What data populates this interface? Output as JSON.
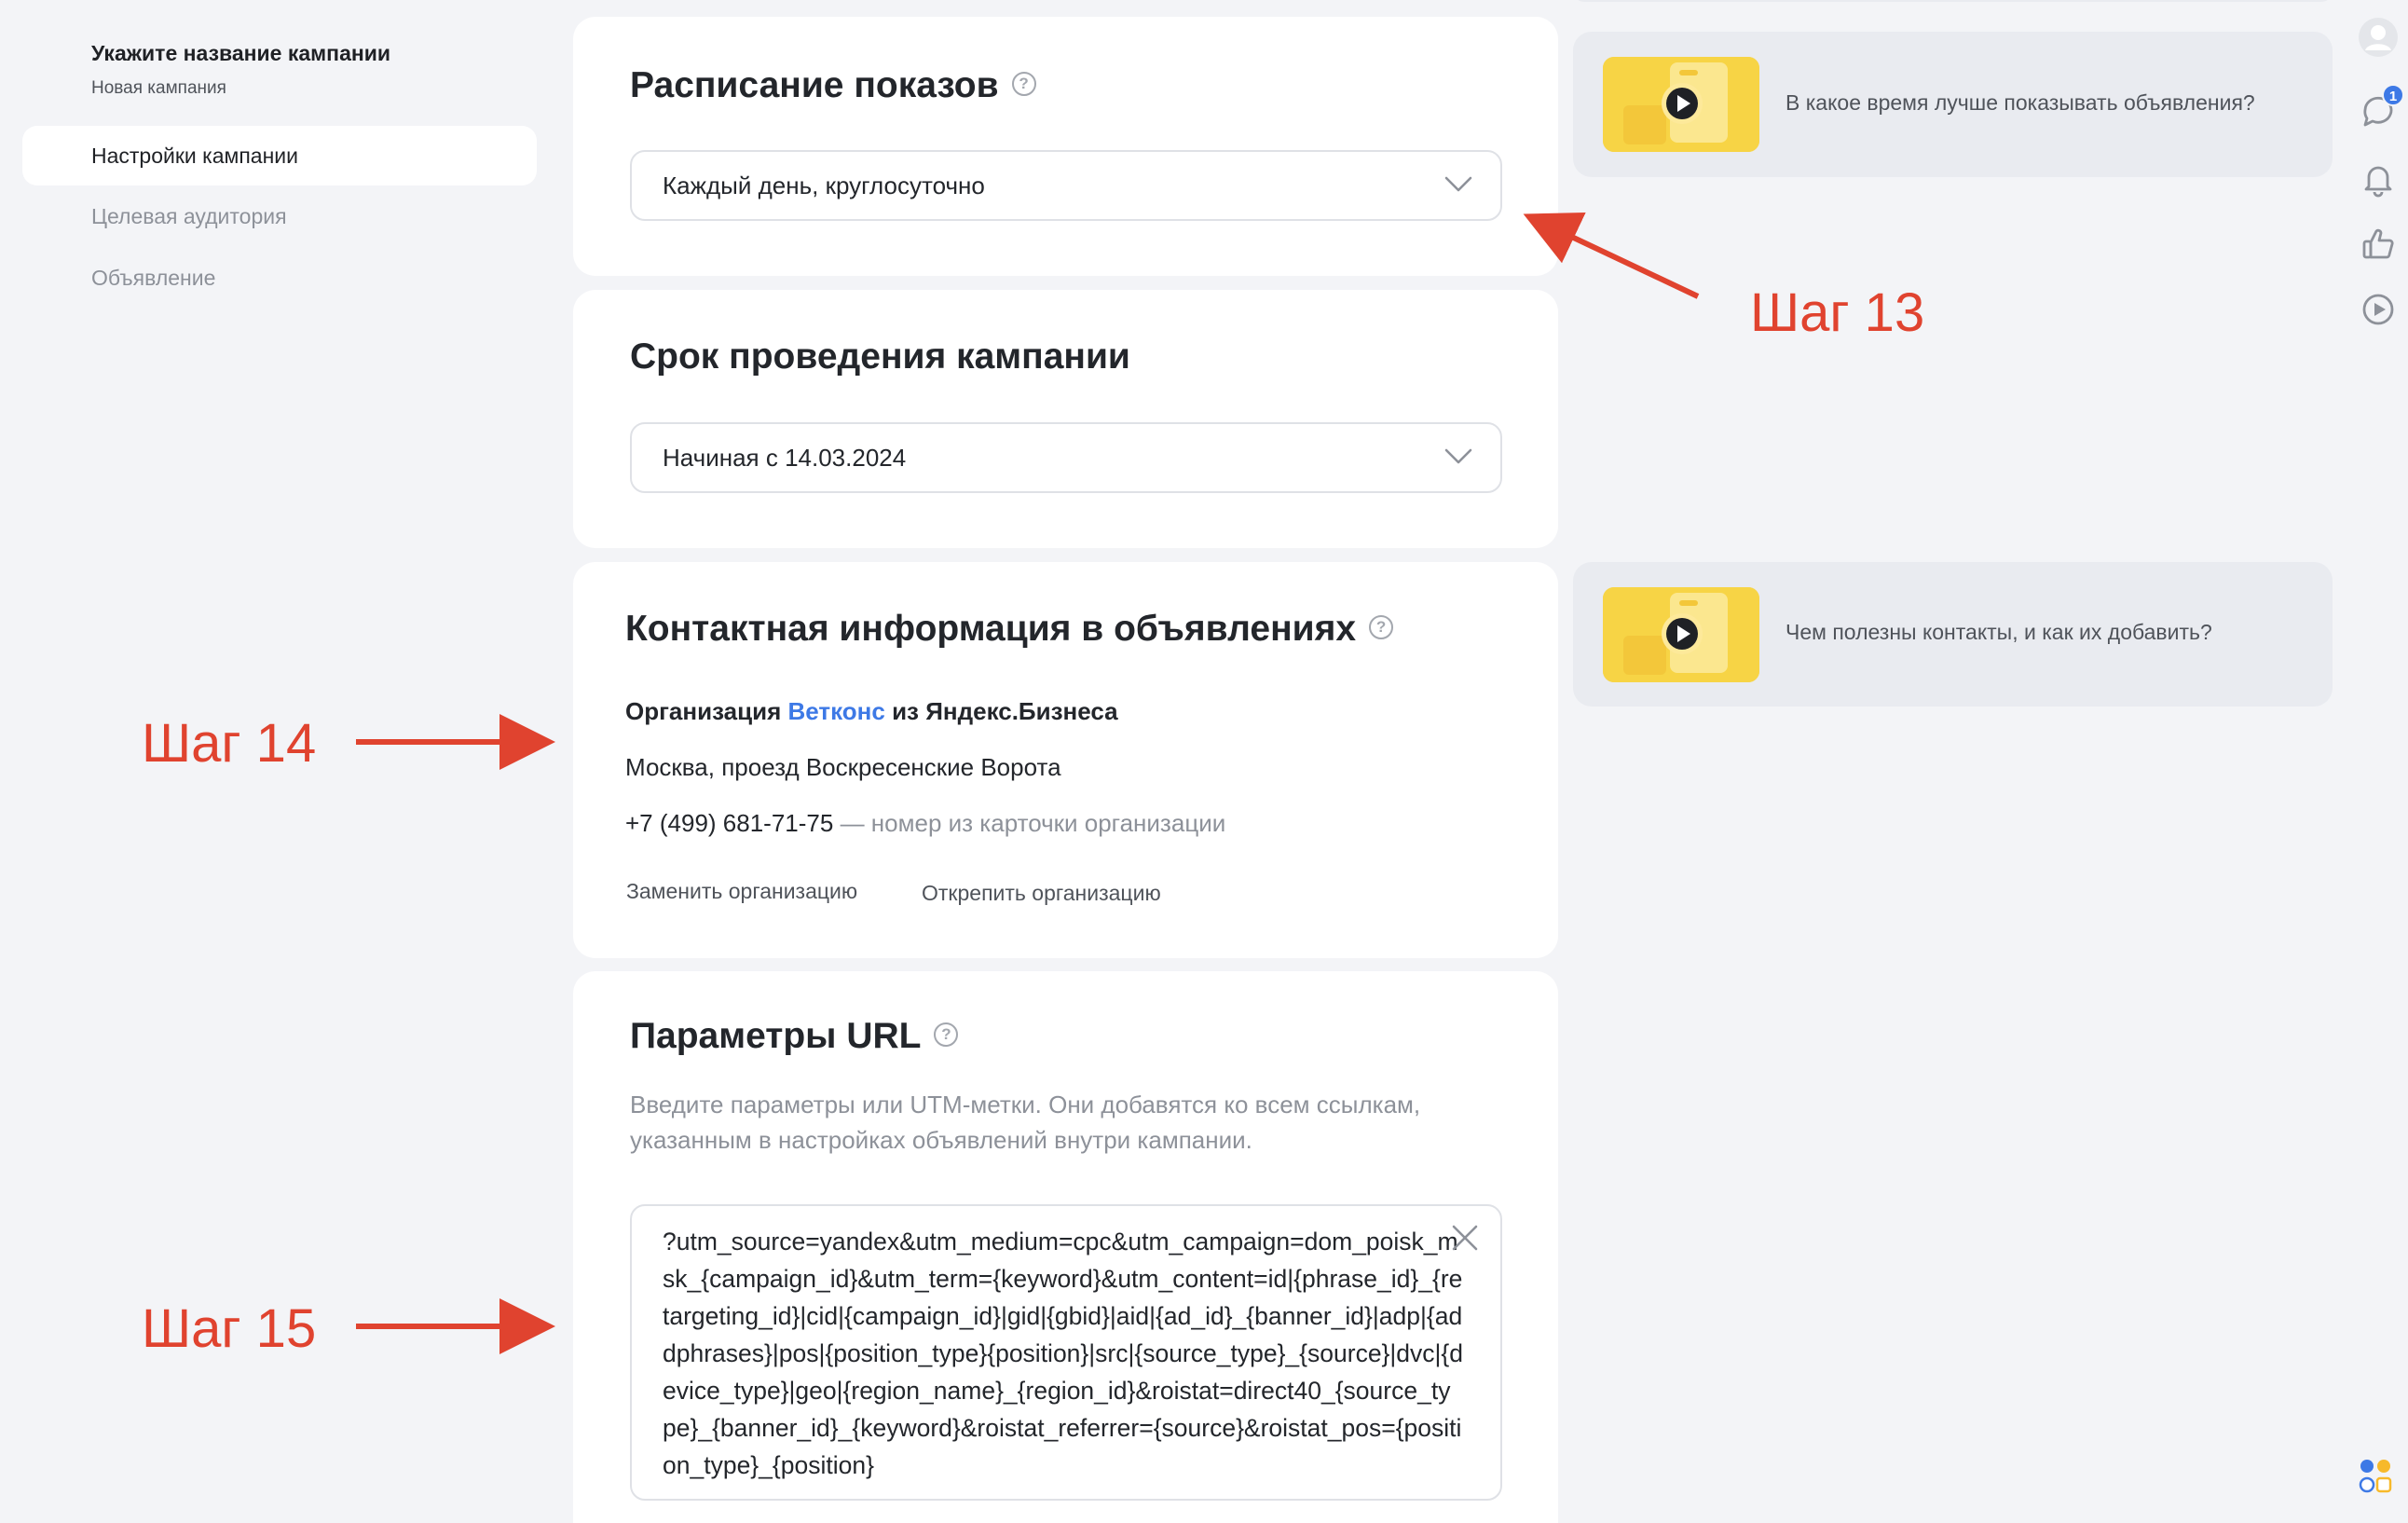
{
  "sidebar": {
    "campaign_title": "Укажите название кампании",
    "campaign_subtitle": "Новая кампания",
    "nav": [
      {
        "label": "Настройки кампании",
        "active": true
      },
      {
        "label": "Целевая аудитория",
        "active": false
      },
      {
        "label": "Объявление",
        "active": false
      }
    ]
  },
  "schedule": {
    "title": "Расписание показов",
    "value": "Каждый день, круглосуточно"
  },
  "period": {
    "title": "Срок проведения кампании",
    "value": "Начиная с 14.03.2024"
  },
  "contacts": {
    "title": "Контактная информация в объявлениях",
    "org_prefix": "Организация",
    "org_name": "Ветконс",
    "org_suffix": "из Яндекс.Бизнеса",
    "address": "Москва, проезд Воскресенские Ворота",
    "phone": "+7 (499) 681-71-75",
    "phone_note": "— номер из карточки организации",
    "replace_link": "Заменить организацию",
    "detach_link": "Открепить организацию"
  },
  "url_params": {
    "title": "Параметры URL",
    "description": "Введите параметры или UTM-метки. Они добавятся ко всем ссылкам, указанным в настройках объявлений внутри кампании.",
    "value": "?utm_source=yandex&utm_medium=cpc&utm_campaign=dom_poisk_msk_{campaign_id}&utm_term={keyword}&utm_content=id|{phrase_id}_{retargeting_id}|cid|{campaign_id}|gid|{gbid}|aid|{ad_id}_{banner_id}|adp|{addphrases}|pos|{position_type}{position}|src|{source_type}_{source}|dvc|{device_type}|geo|{region_name}_{region_id}&roistat=direct40_{source_type}_{banner_id}_{keyword}&roistat_referrer={source}&roistat_pos={position_type}_{position}"
  },
  "tips": [
    {
      "text": "В какое время лучше показывать объявления?"
    },
    {
      "text": "Чем полезны контакты, и как их добавить?"
    }
  ],
  "rail": {
    "messages_badge": "1",
    "icons": [
      "avatar-icon",
      "chat-icon",
      "bell-icon",
      "thumbs-up-icon",
      "play-icon"
    ]
  },
  "annotations": {
    "step13": "Шаг 13",
    "step14": "Шаг 14",
    "step15": "Шаг 15"
  },
  "colors": {
    "accent_link": "#3d79e6",
    "annotation": "#e0432f",
    "badge": "#3d79e6",
    "thumb": "#f7d445"
  }
}
